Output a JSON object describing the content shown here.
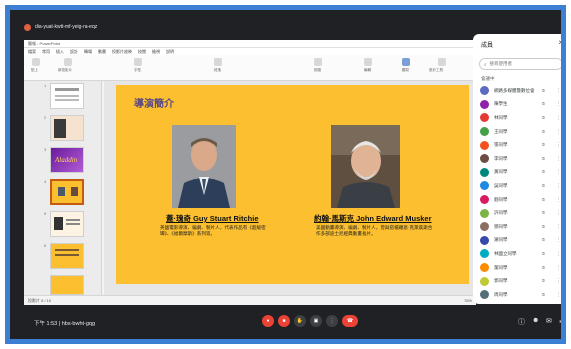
{
  "meet": {
    "window_title": "dia-yuat-kwtt-mf-yeig-ra-eqz",
    "meeting_meta": "下午 1:53 | hbs-bwht-gqg",
    "controls": [
      "mic-off",
      "camera-off",
      "hand",
      "present",
      "more",
      "hangup"
    ]
  },
  "ppt": {
    "title": "簡報 - PowerPoint",
    "tabs": [
      "檔案",
      "常用",
      "插入",
      "設計",
      "轉場",
      "動畫",
      "投影片放映",
      "校閱",
      "檢視",
      "說明"
    ],
    "ribbon_labels": [
      "貼上",
      "新投影片",
      "字型",
      "段落",
      "繪圖",
      "編輯",
      "聽寫",
      "設計工具"
    ],
    "thumbnail_numbers": [
      "1",
      "2",
      "3",
      "4",
      "5",
      "6"
    ],
    "aladdin_text": "Aladdin",
    "status": "投影片 5 / 10",
    "zoom": "78%"
  },
  "slide": {
    "title": "導演簡介",
    "left_caption": "蓋·瑰奇 Guy Stuart Ritchie",
    "left_desc": "英國電影導演、編劇、製片人，代表作品有《超級密罈》、《福爾摩斯》系列等。",
    "right_caption": "約翰·馬斯克 John Edward Musker",
    "right_desc": "美國動畫導演、編劇、製片人，曾與搭檔羅恩·克萊蒺斯合作多部迪士尼經典動畫長片。"
  },
  "people": {
    "header": "成員",
    "search_placeholder": "搜尋使用者",
    "section": "會議中",
    "list": [
      {
        "name": "網路多媒體暨數位會議",
        "color": "#5c6bc0"
      },
      {
        "name": "陳學生",
        "color": "#8e24aa"
      },
      {
        "name": "林同學",
        "color": "#e53935"
      },
      {
        "name": "王同學",
        "color": "#43a047"
      },
      {
        "name": "張同學",
        "color": "#f4511e"
      },
      {
        "name": "李同學",
        "color": "#6d4c41"
      },
      {
        "name": "黃同學",
        "color": "#00897b"
      },
      {
        "name": "吳同學",
        "color": "#1e88e5"
      },
      {
        "name": "劉同學",
        "color": "#d81b60"
      },
      {
        "name": "許同學",
        "color": "#7cb342"
      },
      {
        "name": "鄧同學",
        "color": "#8d6e63"
      },
      {
        "name": "謝同學",
        "color": "#3949ab"
      },
      {
        "name": "林國立同學",
        "color": "#00acc1"
      },
      {
        "name": "葉同學",
        "color": "#fb8c00"
      },
      {
        "name": "郭同學",
        "color": "#c0ca33"
      },
      {
        "name": "周同學",
        "color": "#546e7a"
      },
      {
        "name": "江同學",
        "color": "#ab47bc"
      }
    ]
  },
  "colors": {
    "border": "#3d7fd3",
    "slide_bg": "#fbbf2f",
    "slide_title": "#5a4a86",
    "meet_bg": "#202124"
  }
}
